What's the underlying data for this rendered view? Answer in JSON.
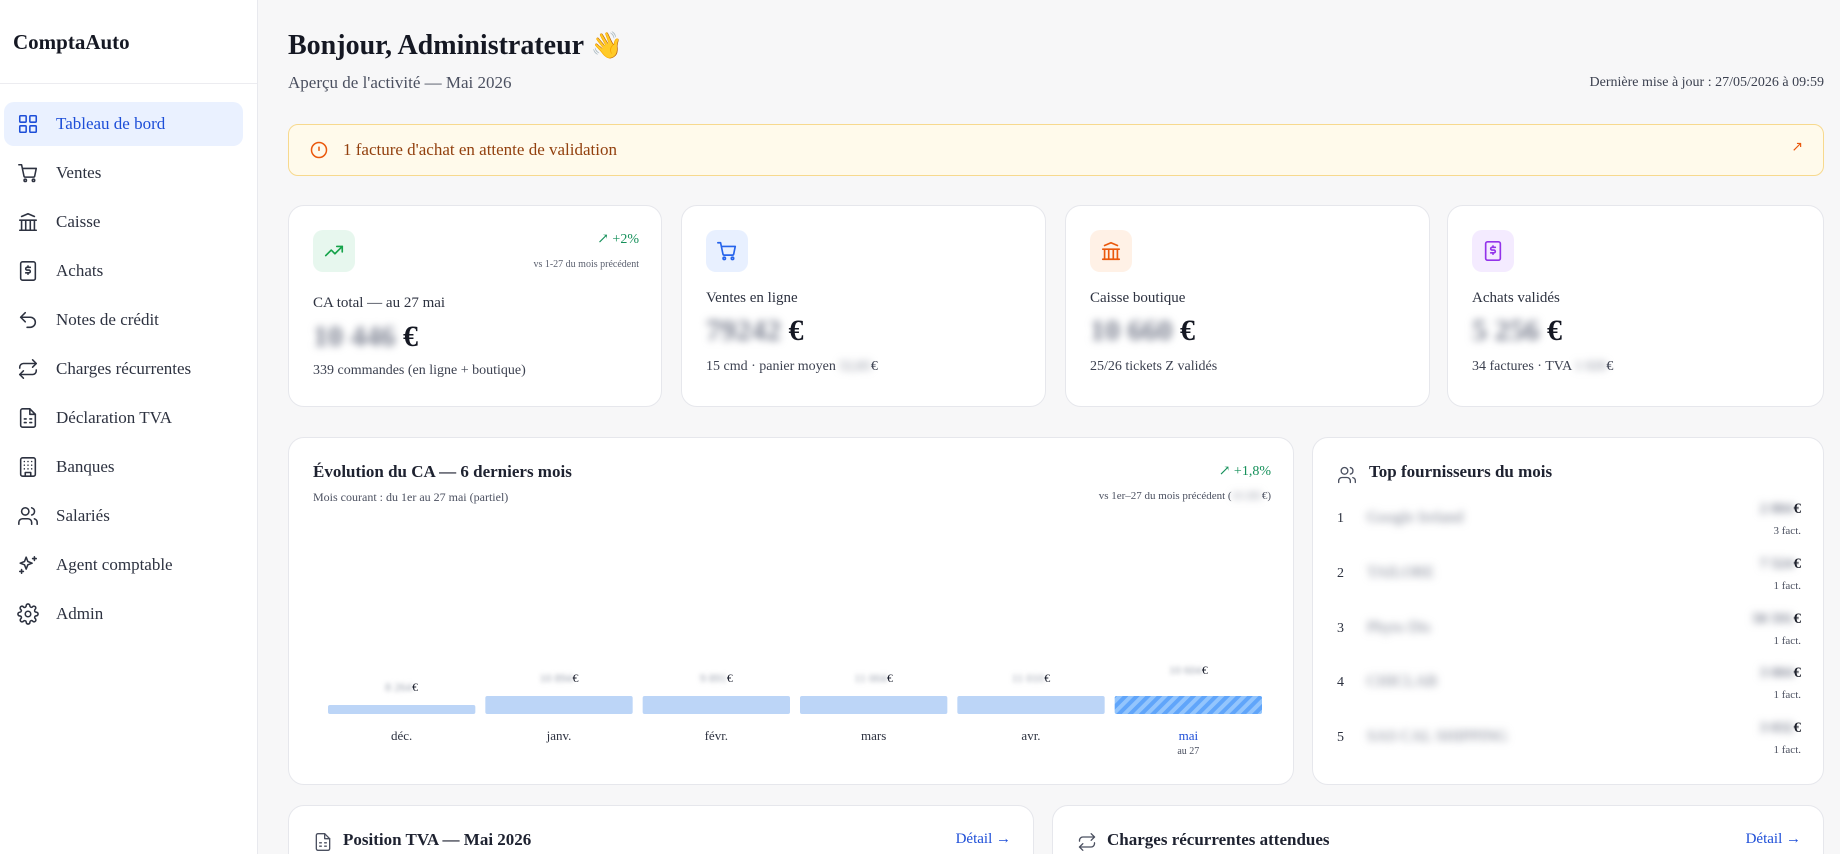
{
  "app": {
    "name": "ComptaAuto"
  },
  "sidebar": {
    "items": [
      {
        "label": "Tableau de bord",
        "icon": "grid-icon"
      },
      {
        "label": "Ventes",
        "icon": "cart-icon"
      },
      {
        "label": "Caisse",
        "icon": "bank-icon"
      },
      {
        "label": "Achats",
        "icon": "receipt-icon"
      },
      {
        "label": "Notes de crédit",
        "icon": "undo-icon"
      },
      {
        "label": "Charges récurrentes",
        "icon": "repeat-icon"
      },
      {
        "label": "Déclaration TVA",
        "icon": "file-icon"
      },
      {
        "label": "Banques",
        "icon": "building-icon"
      },
      {
        "label": "Salariés",
        "icon": "users-icon"
      },
      {
        "label": "Agent comptable",
        "icon": "sparkles-icon"
      },
      {
        "label": "Admin",
        "icon": "gear-icon"
      }
    ]
  },
  "header": {
    "greeting": "Bonjour, Administrateur",
    "greeting_emoji": "👋",
    "subtitle": "Aperçu de l'activité — Mai 2026",
    "last_update": "Dernière mise à jour : 27/05/2026 à 09:59"
  },
  "alert": {
    "text": "1 facture d'achat en attente de validation",
    "arrow": "↗"
  },
  "kpis": [
    {
      "label": "CA total — au 27 mai",
      "value": "10 446",
      "currency": "€",
      "foot": "339 commandes (en ligne + boutique)",
      "trend": "↗ +2%",
      "trend_note": "vs 1-27 du mois précédent",
      "icon": "trending-up-icon",
      "color": "#16a34a"
    },
    {
      "label": "Ventes en ligne",
      "value": "79242",
      "currency": "€",
      "foot": "15 cmd · panier moyen",
      "foot_blur": "52,83",
      "foot_suffix": "€",
      "icon": "cart-icon",
      "color": "#2563eb"
    },
    {
      "label": "Caisse boutique",
      "value": "10 660",
      "currency": "€",
      "foot": "25/26 tickets Z validés",
      "icon": "bank-icon",
      "color": "#ea580c"
    },
    {
      "label": "Achats validés",
      "value": "5 256",
      "currency": "€",
      "foot": "34 factures · TVA",
      "foot_blur": "1 020",
      "foot_suffix": "€",
      "icon": "receipt-icon",
      "color": "#9333ea"
    }
  ],
  "chart": {
    "title": "Évolution du CA — 6 derniers mois",
    "subtitle": "Mois courant : du 1er au 27 mai (partiel)",
    "trend": "↗ +1,8%",
    "note": "vs 1er–27 du mois précédent (",
    "note_blur": "10 265",
    "note_suffix": "€)"
  },
  "chart_data": {
    "type": "bar",
    "categories": [
      "déc.",
      "janv.",
      "févr.",
      "mars",
      "avr.",
      "mai"
    ],
    "values": [
      3,
      6,
      6,
      6,
      6,
      6
    ],
    "value_labels": [
      "8 264",
      "10 894",
      "9 891",
      "11 004",
      "11 010",
      "10 604"
    ],
    "currency": "€",
    "last_sublabel": "au 27",
    "bar_color": "#bcd5f7",
    "current_color": "#60a5fa",
    "ylim": [
      0,
      100
    ]
  },
  "suppliers": {
    "title": "Top fournisseurs du mois",
    "rows": [
      {
        "rank": "1",
        "name": "Google Ireland",
        "amount": "2 804",
        "count": "3 fact."
      },
      {
        "rank": "2",
        "name": "TAILORE",
        "amount": "7 524",
        "count": "1 fact."
      },
      {
        "rank": "3",
        "name": "Phyto Dis",
        "amount": "58 591",
        "count": "1 fact."
      },
      {
        "rank": "4",
        "name": "CHICLAB",
        "amount": "3 004",
        "count": "1 fact."
      },
      {
        "rank": "5",
        "name": "SAS CAL SHIPPING",
        "amount": "3 032",
        "count": "1 fact."
      }
    ]
  },
  "bottom": {
    "vat": {
      "title": "Position TVA — Mai 2026",
      "link": "Détail →"
    },
    "charges": {
      "title": "Charges récurrentes attendues",
      "link": "Détail →"
    }
  }
}
